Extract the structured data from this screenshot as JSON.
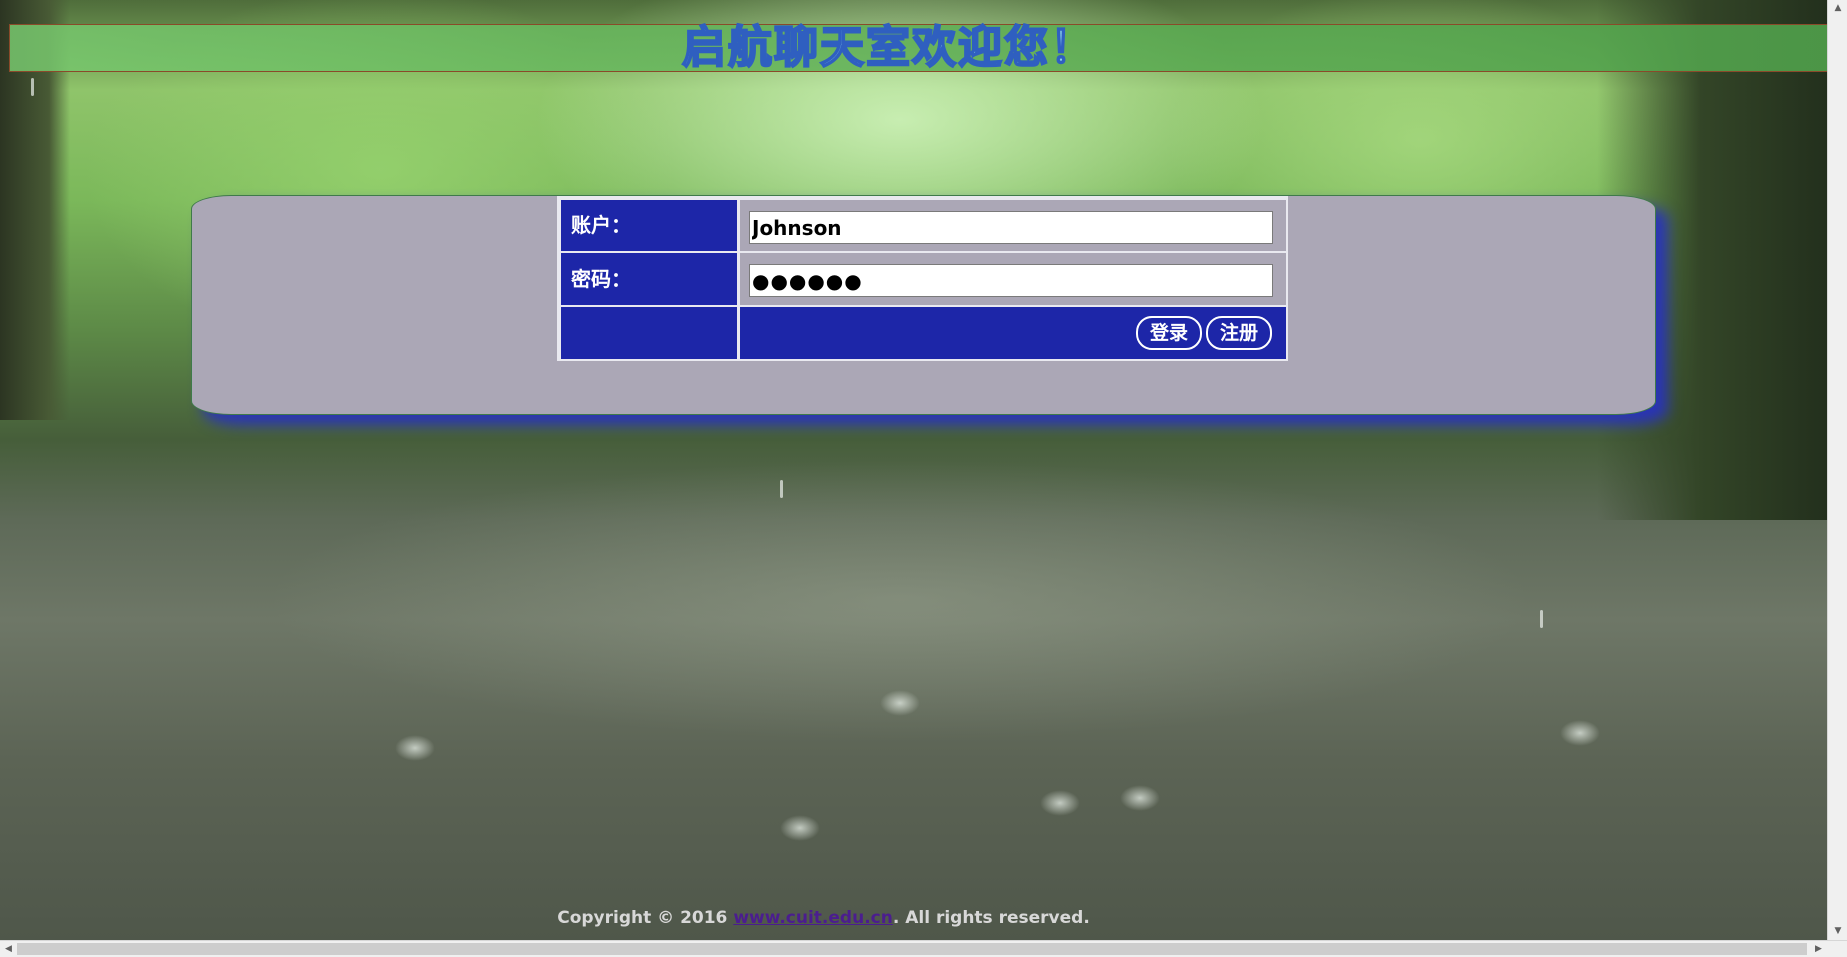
{
  "banner": {
    "title": "启航聊天室欢迎您！"
  },
  "login_form": {
    "account_label": "账户：",
    "account_value": "Johnson",
    "password_label": "密码：",
    "password_value": "●●●●●●",
    "login_button": "登录",
    "register_button": "注册"
  },
  "footer": {
    "prefix": "Copyright © 2016 ",
    "link_text": "www.cuit.edu.cn",
    "suffix": ". All rights reserved."
  },
  "colors": {
    "banner_green": "#5faf55",
    "panel_gray": "#aba7b6",
    "form_blue": "#1d26a8",
    "title_cyan": "#8ed4ea",
    "link_purple": "#4b1d8f"
  },
  "scrollbars": {
    "up_icon": "arrow-up-icon",
    "down_icon": "arrow-down-icon",
    "left_icon": "arrow-left-icon",
    "right_icon": "arrow-right-icon"
  }
}
